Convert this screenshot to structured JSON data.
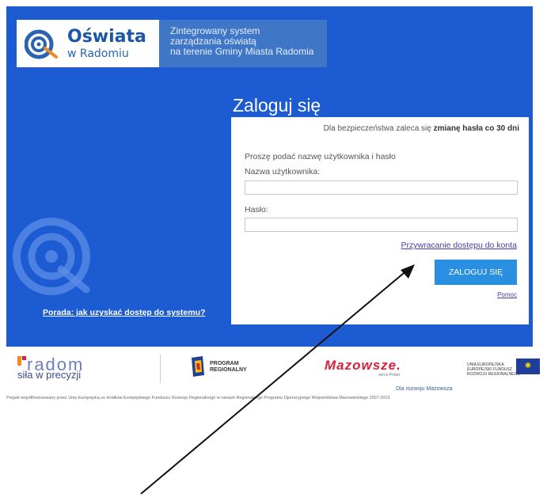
{
  "header": {
    "logo_title": "Oświata",
    "logo_subtitle": "w Radomiu",
    "desc_line1": "Zintegrowany system",
    "desc_line2": "zarządzania oświatą",
    "desc_line3": "na terenie Gminy Miasta Radomia"
  },
  "login": {
    "title": "Zaloguj się",
    "security_prefix": "Dla bezpieczeństwa zaleca się ",
    "security_bold": "zmianę hasła co 30 dni",
    "prompt": "Proszę podać nazwę użytkownika i hasło",
    "username_label": "Nazwa użytkownika:",
    "username_value": "",
    "password_label": "Hasło:",
    "password_value": "",
    "restore_link": "Przywracanie dostępu do konta",
    "login_button": "ZALOGUJ SIĘ",
    "help_link": "Pomoc"
  },
  "tip_link": "Porada: jak uzyskać dostęp do systemu?",
  "footer": {
    "radom_name": "radom",
    "radom_tagline": "siła w precyzji",
    "program_line1": "PROGRAM",
    "program_line2": "REGIONALNY",
    "mazowsze": "Mazowsze.",
    "mazowsze_sub": "serce Polski",
    "eu_line1": "UNIA EUROPEJSKA",
    "eu_line2": "EUROPEJSKI FUNDUSZ",
    "eu_line3": "ROZWOJU REGIONALNEGO",
    "mazowsze_note": "Dla rozwoju Mazowsza",
    "funding_note": "Projekt współfinansowany przez Unię Europejską ze środków Europejskiego Funduszu Rozwoju Regionalnego w ramach Regionalnego Programu Operacyjnego Województwa Mazowieckiego 2007-2013"
  },
  "colors": {
    "panel_blue": "#1c5bd2",
    "button_blue": "#2a8fe0",
    "link_purple": "#4b3aa6"
  }
}
